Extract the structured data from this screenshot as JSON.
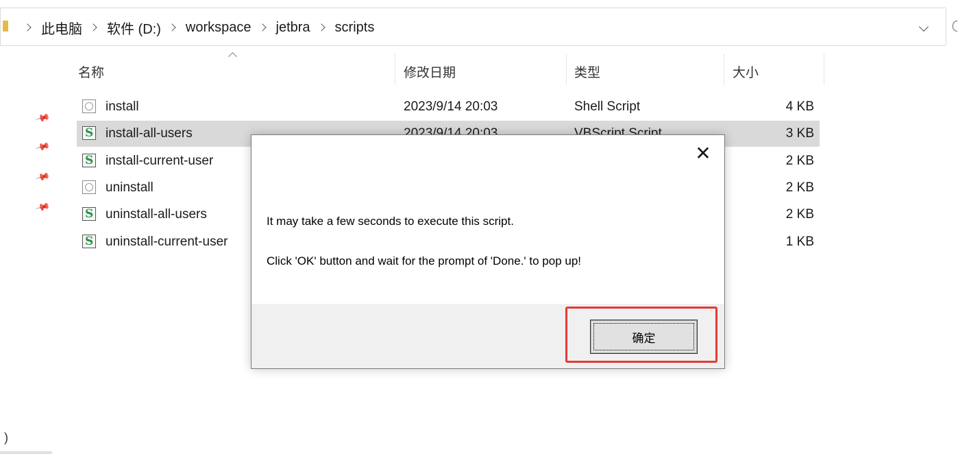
{
  "breadcrumb": [
    "此电脑",
    "软件 (D:)",
    "workspace",
    "jetbra",
    "scripts"
  ],
  "columns": {
    "name": "名称",
    "date": "修改日期",
    "type": "类型",
    "size": "大小"
  },
  "files": [
    {
      "name": "install",
      "date": "2023/9/14 20:03",
      "type": "Shell Script",
      "size": "4 KB",
      "icon": "shell-script-icon"
    },
    {
      "name": "install-all-users",
      "date": "2023/9/14 20:03",
      "type": "VBScript Script",
      "size": "3 KB",
      "icon": "vbscript-icon"
    },
    {
      "name": "install-current-user",
      "date": "",
      "type": "",
      "size": "2 KB",
      "icon": "vbscript-icon"
    },
    {
      "name": "uninstall",
      "date": "",
      "type": "",
      "size": "2 KB",
      "icon": "shell-script-icon"
    },
    {
      "name": "uninstall-all-users",
      "date": "",
      "type": "",
      "size": "2 KB",
      "icon": "vbscript-icon"
    },
    {
      "name": "uninstall-current-user",
      "date": "",
      "type": "",
      "size": "1 KB",
      "icon": "vbscript-icon"
    }
  ],
  "dialog": {
    "message_line1": "It may take a few seconds to execute this script.",
    "message_line2": "Click 'OK' button and wait for the prompt of 'Done.' to pop up!",
    "ok_label": "确定",
    "close_glyph": "✕"
  },
  "left_pane_char": ")",
  "colors": {
    "highlight": "#e53935",
    "selected_row": "#d9d9d9",
    "dialog_footer": "#f0f0f0"
  }
}
